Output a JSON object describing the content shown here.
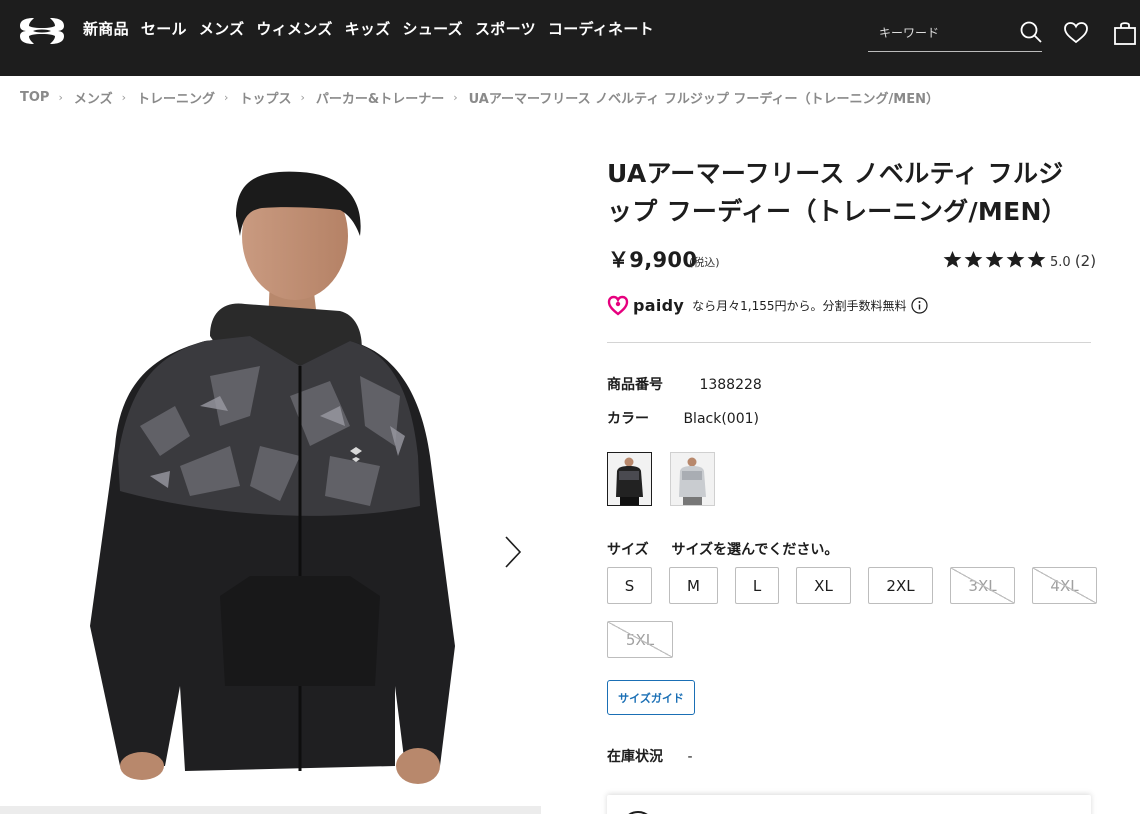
{
  "header": {
    "nav": [
      "新商品",
      "セール",
      "メンズ",
      "ウィメンズ",
      "キッズ",
      "シューズ",
      "スポーツ",
      "コーディネート"
    ],
    "search_placeholder": "キーワード"
  },
  "breadcrumb": [
    "TOP",
    "メンズ",
    "トレーニング",
    "トップス",
    "パーカー&トレーナー",
    "UAアーマーフリース ノベルティ フルジップ フーディー（トレーニング/MEN）"
  ],
  "product": {
    "title": "UAアーマーフリース ノベルティ フルジップ フーディー（トレーニング/MEN）",
    "price": "￥9,900",
    "tax_note": "(税込)",
    "rating": "5.0",
    "review_count": "(2)",
    "stars": 5,
    "paidy": {
      "brand": "paidy",
      "text": "なら月々1,155円から。分割手数料無料"
    },
    "specs": {
      "number_label": "商品番号",
      "number_value": "1388228",
      "color_label": "カラー",
      "color_value": "Black(001)"
    },
    "size": {
      "label": "サイズ",
      "prompt": "サイズを選んでください。",
      "options": [
        {
          "label": "S",
          "available": true
        },
        {
          "label": "M",
          "available": true
        },
        {
          "label": "L",
          "available": true
        },
        {
          "label": "XL",
          "available": true
        },
        {
          "label": "2XL",
          "available": true
        },
        {
          "label": "3XL",
          "available": false
        },
        {
          "label": "4XL",
          "available": false
        },
        {
          "label": "5XL",
          "available": false
        }
      ]
    },
    "size_guide": "サイズガイド",
    "stock_label": "在庫状況",
    "stock_value": "-"
  },
  "colors": {
    "header_bg": "#1d1d1d",
    "accent_blue": "#1a6fb5",
    "paidy_pink": "#e6007e"
  }
}
